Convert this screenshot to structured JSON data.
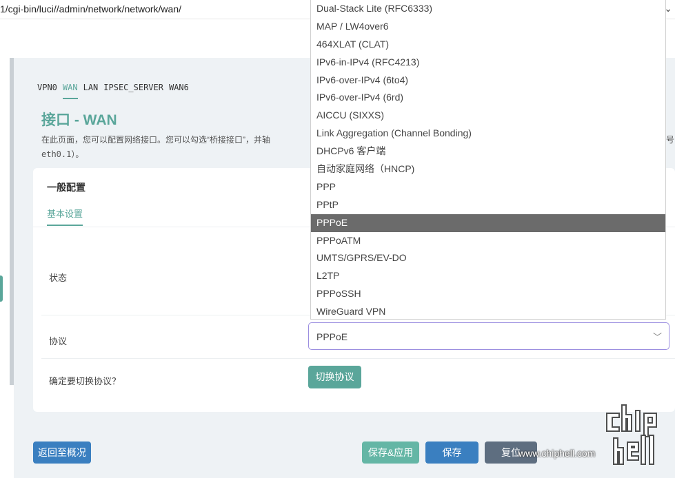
{
  "browser": {
    "url": "1/cgi-bin/luci//admin/network/network/wan/"
  },
  "tabs": [
    "VPN0",
    "WAN",
    "LAN",
    "IPSEC_SERVER",
    "WAN6"
  ],
  "page": {
    "title": "接口 - WAN",
    "description_line1": "在此页面，您可以配置网络接口。您可以勾选“桥接接口”，并轴",
    "description_line2": "eth0.1）。",
    "description_right_fragment": "号"
  },
  "card": {
    "title": "一般配置",
    "subtab": "基本设置",
    "status_label": "状态",
    "protocol_label": "协议",
    "confirm_label": "确定要切换协议？",
    "protocol_value": "PPPoE",
    "switch_button": "切换协议"
  },
  "dropdown": {
    "options": [
      "Dual-Stack Lite (RFC6333)",
      "MAP / LW4over6",
      "464XLAT (CLAT)",
      "IPv6-in-IPv4 (RFC4213)",
      "IPv6-over-IPv4 (6to4)",
      "IPv6-over-IPv4 (6rd)",
      "AICCU (SIXXS)",
      "Link Aggregation (Channel Bonding)",
      "DHCPv6 客户端",
      "自动家庭网络（HNCP)",
      "PPP",
      "PPtP",
      "PPPoE",
      "PPPoATM",
      "UMTS/GPRS/EV-DO",
      "L2TP",
      "PPPoSSH",
      "WireGuard VPN"
    ],
    "selected": "PPPoE"
  },
  "footer": {
    "back": "返回至概况",
    "save_apply": "保存&应用",
    "save": "保存",
    "reset": "复位"
  },
  "watermark": {
    "url": "www.chiphell.com"
  }
}
